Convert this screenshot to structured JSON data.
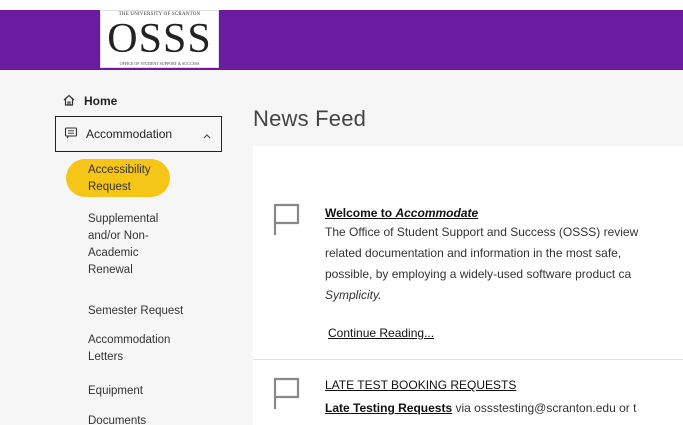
{
  "header": {
    "logo_top_text": "THE UNIVERSITY OF SCRANTON",
    "logo_main_text": "OSSS",
    "logo_sub_text": "OFFICE OF STUDENT SUPPORT & SUCCESS",
    "brand_color": "#6a1b9f"
  },
  "sidebar": {
    "home_label": "Home",
    "accommodation_label": "Accommodation",
    "items": [
      {
        "label_line1": "Accessibility",
        "label_line2": "Request",
        "active": true
      },
      {
        "label_line1": "Supplemental",
        "label_line2": "and/or Non-",
        "label_line3": "Academic",
        "label_line4": "Renewal"
      },
      {
        "label_line1": "Semester Request"
      },
      {
        "label_line1": "Accommodation",
        "label_line2": "Letters"
      },
      {
        "label_line1": "Equipment"
      },
      {
        "label_line1": "Documents"
      }
    ],
    "highlight_color": "#f5c518"
  },
  "main": {
    "title": "News Feed",
    "posts": [
      {
        "title_prefix": "Welcome to ",
        "title_emph": "Accommodate",
        "lines": [
          "The Office of Student Support and Success (OSSS) review",
          "related documentation and information in the most safe,",
          "possible, by employing a widely-used software product ca",
          "Symplicity."
        ],
        "continue_label": "Continue Reading..."
      },
      {
        "title": "LATE TEST BOOKING REQUESTS",
        "body_link": "Late Testing Requests",
        "body_rest": " via ossstesting@scranton.edu or t"
      }
    ]
  }
}
